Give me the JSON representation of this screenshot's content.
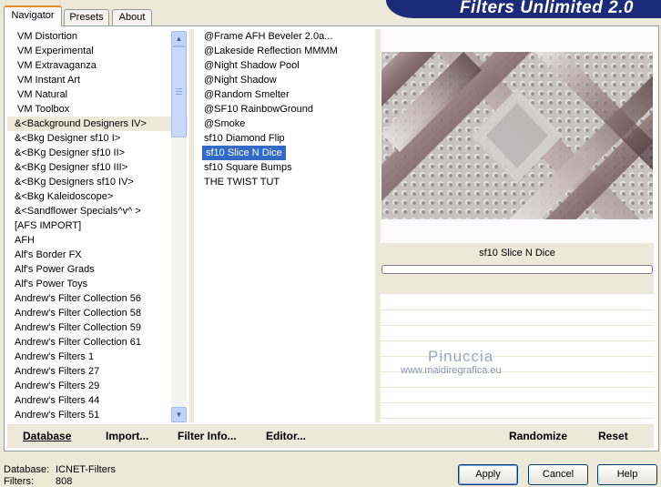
{
  "app": {
    "title": "Filters Unlimited 2.0"
  },
  "tabs": [
    {
      "label": "Navigator"
    },
    {
      "label": "Presets"
    },
    {
      "label": "About"
    }
  ],
  "categories": [
    "VM Distortion",
    "VM Experimental",
    "VM Extravaganza",
    "VM Instant Art",
    "VM Natural",
    "VM Toolbox",
    "&<Background Designers IV>",
    "&<Bkg Designer sf10 I>",
    "&<BKg Designer sf10 II>",
    "&<BKg Designer sf10 III>",
    "&<BKg Designers sf10 IV>",
    "&<Bkg Kaleidoscope>",
    "&<Sandflower Specials^v^ >",
    "[AFS IMPORT]",
    "AFH",
    "Alf's Border FX",
    "Alf's Power Grads",
    "Alf's Power Toys",
    "Andrew's Filter Collection 56",
    "Andrew's Filter Collection 58",
    "Andrew's Filter Collection 59",
    "Andrew's Filter Collection 61",
    "Andrew's Filters 1",
    "Andrew's Filters 27",
    "Andrew's Filters 29",
    "Andrew's Filters 44",
    "Andrew's Filters 51"
  ],
  "filters": [
    "@Frame AFH Beveler 2.0a...",
    "@Lakeside Reflection MMMM",
    "@Night Shadow Pool",
    "@Night Shadow",
    "@Random Smelter",
    "@SF10 RainbowGround",
    "@Smoke",
    "sf10 Diamond Flip",
    "sf10 Slice N Dice",
    "sf10 Square Bumps",
    "THE TWIST TUT"
  ],
  "selected_filter_name": "sf10 Slice N Dice",
  "watermark": {
    "line1": "Pinuccia",
    "line2": "www.maidiregrafica.eu"
  },
  "toolbar": {
    "database": "Database",
    "import": "Import...",
    "filter_info": "Filter Info...",
    "editor": "Editor...",
    "randomize": "Randomize",
    "reset": "Reset"
  },
  "status": {
    "database_label": "Database:",
    "database_value": "ICNET-Filters",
    "filters_label": "Filters:",
    "filters_value": "808"
  },
  "buttons": {
    "apply": "Apply",
    "cancel": "Cancel",
    "help": "Help"
  },
  "colors": {
    "selection": "#316ac5",
    "window_bg": "#ece9d8",
    "brand_bg": "#1c2a7a"
  }
}
